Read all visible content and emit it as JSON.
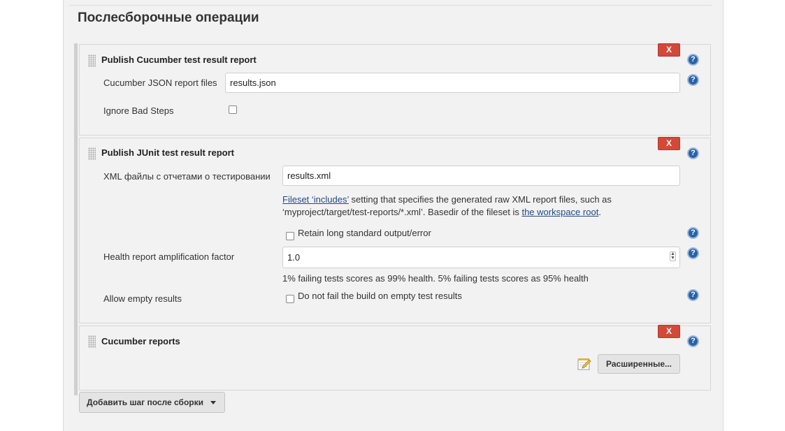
{
  "section": {
    "title": "Послесборочные операции"
  },
  "cucumber_result": {
    "title": "Publish Cucumber test result report",
    "delete_label": "X",
    "help_label": "?",
    "json_label": "Cucumber JSON report files",
    "json_value": "results.json",
    "ignore_label": "Ignore Bad Steps",
    "ignore_checked": false
  },
  "junit": {
    "title": "Publish JUnit test result report",
    "delete_label": "X",
    "help_label": "?",
    "xml_label": "XML файлы с отчетами о тестировании",
    "xml_value": "results.xml",
    "desc_link1": "Fileset ‘includes’",
    "desc_text1": " setting that specifies the generated raw XML report files, such as",
    "desc_text2": "‘myproject/target/test-reports/*.xml’. Basedir of the fileset is ",
    "desc_link2": "the workspace root",
    "desc_text3": ".",
    "retain_label": "Retain long standard output/error",
    "retain_checked": false,
    "health_label": "Health report amplification factor",
    "health_value": "1.0",
    "health_desc": "1% failing tests scores as 99% health. 5% failing tests scores as 95% health",
    "allow_empty_label": "Allow empty results",
    "allow_empty_checkbox_label": "Do not fail the build on empty test results",
    "allow_empty_checked": false
  },
  "cucumber_reports": {
    "title": "Cucumber reports",
    "delete_label": "X",
    "help_label": "?",
    "advanced_label": "Расширенные..."
  },
  "add_step": {
    "label": "Добавить шаг после сборки"
  },
  "colors": {
    "delete": "#d24939",
    "help": "#2a62a8",
    "link": "#204a87"
  }
}
